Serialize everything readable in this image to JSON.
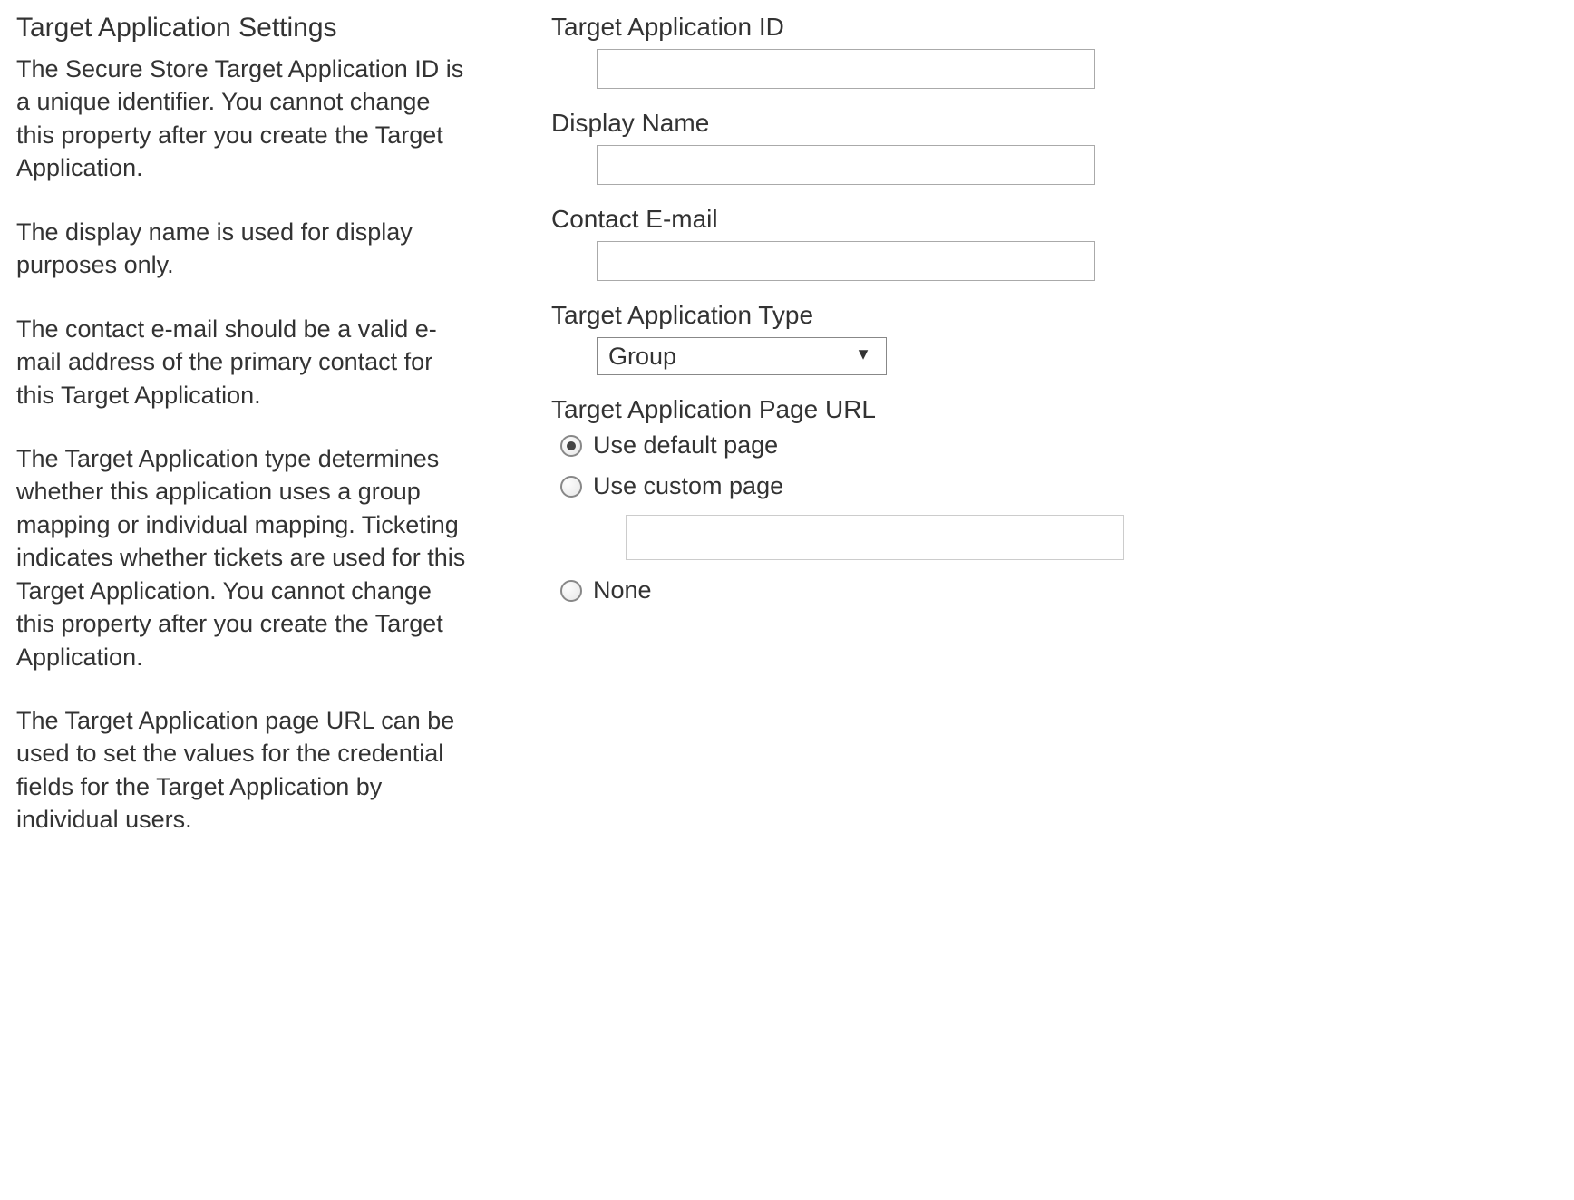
{
  "left": {
    "title": "Target Application Settings",
    "paragraphs": [
      "The Secure Store Target Application ID is a unique identifier. You cannot change this property after you create the Target Application.",
      "The display name is used for display purposes only.",
      "The contact e-mail should be a valid e-mail address of the primary contact for this Target Application.",
      "The Target Application type determines whether this application uses a group mapping or individual mapping. Ticketing indicates whether tickets are used for this Target Application. You cannot change this property after you create the Target Application.",
      "The Target Application page URL can be used to set the values for the credential fields for the Target Application by individual users."
    ]
  },
  "right": {
    "target_app_id": {
      "label": "Target Application ID",
      "value": ""
    },
    "display_name": {
      "label": "Display Name",
      "value": ""
    },
    "contact_email": {
      "label": "Contact E-mail",
      "value": ""
    },
    "target_app_type": {
      "label": "Target Application Type",
      "selected": "Group"
    },
    "page_url": {
      "label": "Target Application Page URL",
      "options": {
        "default": {
          "label": "Use default page",
          "selected": true
        },
        "custom": {
          "label": "Use custom page",
          "selected": false,
          "value": ""
        },
        "none": {
          "label": "None",
          "selected": false
        }
      }
    }
  }
}
